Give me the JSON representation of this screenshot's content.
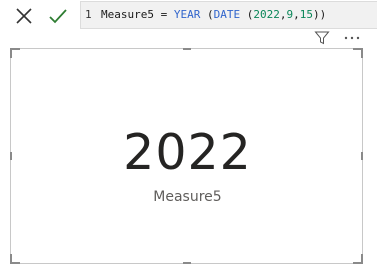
{
  "formula_bar": {
    "cancel_icon": "x-icon",
    "commit_icon": "check-icon",
    "line_number": "1",
    "formula": {
      "measure_name": "Measure5",
      "equals": " = ",
      "func_year": "YEAR",
      "open1": " (",
      "func_date": "DATE",
      "open2": " (",
      "arg_year": "2022",
      "comma1": ",",
      "arg_month": "9",
      "comma2": ",",
      "arg_day": "15",
      "close": "))"
    },
    "colors": {
      "keyword": "#3165cc",
      "number": "#098658",
      "background": "#f1f1f1",
      "commit": "#2e7d32"
    }
  },
  "visual_toolbar": {
    "filter_icon": "filter-icon",
    "more_icon": "more-options-icon"
  },
  "card": {
    "value": "2022",
    "label": "Measure5"
  }
}
